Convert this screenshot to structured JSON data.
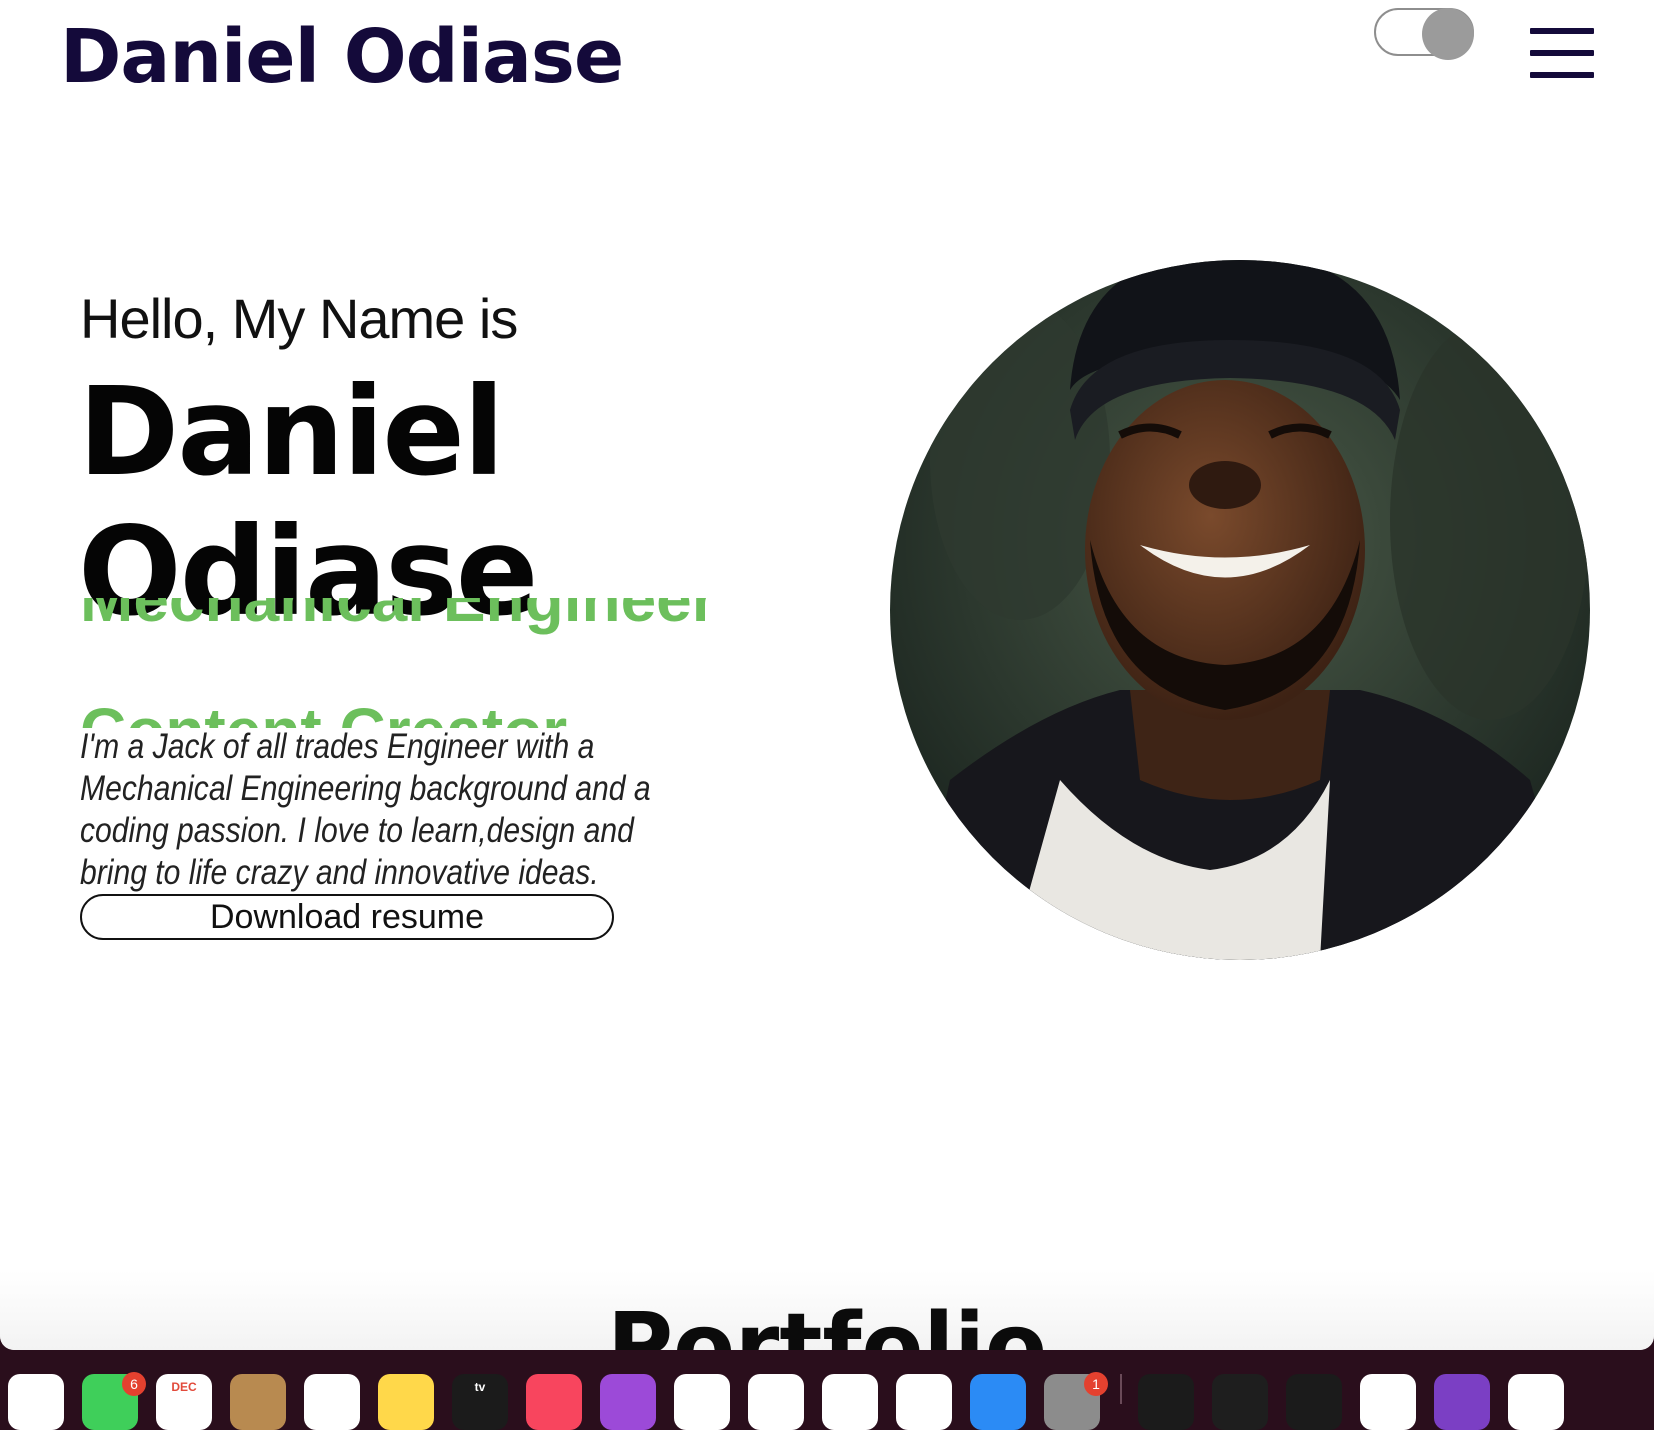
{
  "header": {
    "brand": "Daniel Odiase",
    "theme_toggle_state": "on",
    "menu_icon": "hamburger-icon"
  },
  "hero": {
    "greeting": "Hello, My Name is",
    "name_line1": "Daniel",
    "name_line2": "Odiase",
    "roles": [
      "Mechanical Engineer",
      "Content Creator"
    ],
    "bio": "I'm a Jack of all trades Engineer with a Mechanical Engineering background and a coding passion. I love to learn,design and bring to life crazy and innovative ideas.",
    "resume_button": "Download resume",
    "avatar": "profile-photo"
  },
  "next_section": {
    "title": "Portfolio"
  },
  "colors": {
    "brand": "#140a3a",
    "role_accent": "#6cbf5c",
    "dock_bg": "#2a0e1c"
  },
  "dock": {
    "items": [
      {
        "name": "photos-icon",
        "color": "#ffffff"
      },
      {
        "name": "facetime-icon",
        "color": "#3fcf5a",
        "badge": "6"
      },
      {
        "name": "calendar-icon",
        "color": "#ffffff",
        "label": "DEC"
      },
      {
        "name": "contacts-icon",
        "color": "#b88a50"
      },
      {
        "name": "reminders-icon",
        "color": "#ffffff"
      },
      {
        "name": "notes-icon",
        "color": "#ffd84a"
      },
      {
        "name": "apple-tv-icon",
        "color": "#1b1b1b",
        "label": "tv"
      },
      {
        "name": "music-icon",
        "color": "#f8455e"
      },
      {
        "name": "podcasts-icon",
        "color": "#9c4ad8"
      },
      {
        "name": "news-icon",
        "color": "#ffffff"
      },
      {
        "name": "keynote-icon",
        "color": "#ffffff"
      },
      {
        "name": "numbers-icon",
        "color": "#ffffff"
      },
      {
        "name": "pages-icon",
        "color": "#ffffff"
      },
      {
        "name": "app-store-icon",
        "color": "#2b8bf5"
      },
      {
        "name": "system-settings-icon",
        "color": "#8c8c8c",
        "badge": "1"
      },
      {
        "name": "terminal-icon",
        "color": "#1b1b1b"
      },
      {
        "name": "figma-icon",
        "color": "#1e1e1e"
      },
      {
        "name": "activity-monitor-icon",
        "color": "#1b1b1b"
      },
      {
        "name": "chrome-icon",
        "color": "#ffffff"
      },
      {
        "name": "github-desktop-icon",
        "color": "#7b3fc4"
      },
      {
        "name": "vscode-icon",
        "color": "#ffffff"
      }
    ]
  }
}
